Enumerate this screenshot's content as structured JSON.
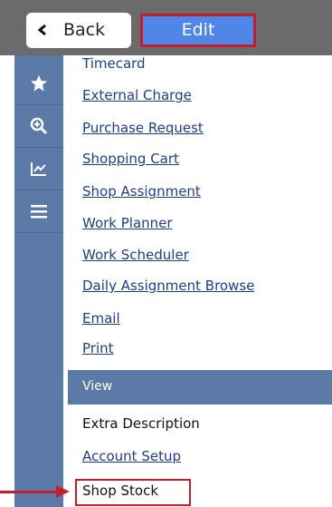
{
  "toolbar": {
    "back_label": "Back",
    "edit_label": "Edit"
  },
  "sidebar": {
    "icons": [
      "star-icon",
      "zoom-in-icon",
      "trend-chart-icon",
      "hamburger-menu-icon"
    ]
  },
  "menu": {
    "links": [
      "Timecard",
      "External Charge",
      "Purchase Request",
      "Shopping Cart",
      "Shop Assignment",
      "Work Planner",
      "Work Scheduler",
      "Daily Assignment Browse",
      "Email",
      "Print"
    ],
    "view_header": "View",
    "view_items": {
      "extra_description": "Extra Description",
      "account_setup": "Account Setup",
      "shop_stock": "Shop Stock"
    }
  },
  "colors": {
    "sidebar": "#5c7aa8",
    "topbar": "#6b6b6b",
    "edit_button": "#4f86e8",
    "highlight": "#c41e2a",
    "link": "#1f3d8a"
  }
}
